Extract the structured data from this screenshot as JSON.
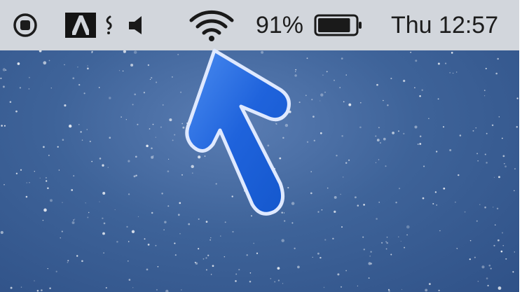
{
  "menubar": {
    "icons": {
      "record": "record-icon",
      "adobe": "adobe-icon",
      "partial": "partial-menu-icon",
      "volume": "volume-icon",
      "wifi": "wifi-icon",
      "battery": "battery-icon"
    },
    "battery_percent_label": "91%",
    "battery_level": 0.91,
    "clock": "Thu 12:57"
  },
  "colors": {
    "menubar_bg": "#d2d6dc",
    "desktop_blue": "#3e6399",
    "arrow_blue": "#1f63dc"
  },
  "overlay": {
    "arrow_icon": "pointer-arrow-icon"
  }
}
